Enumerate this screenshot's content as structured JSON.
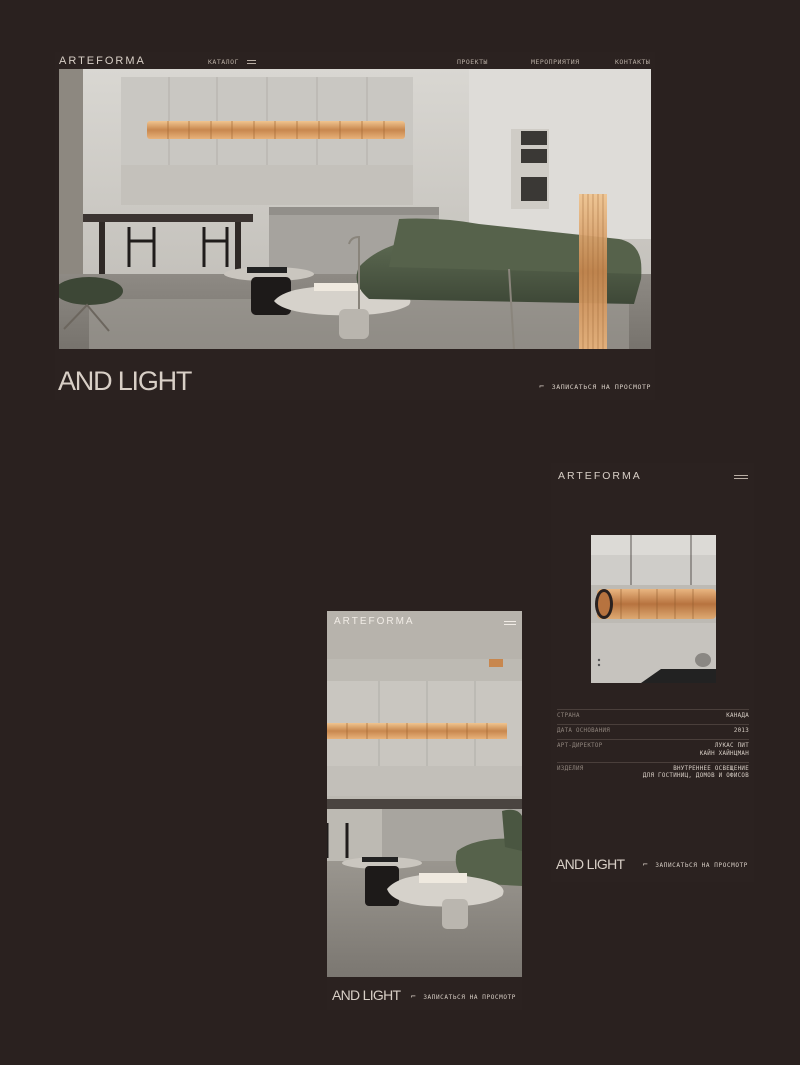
{
  "brand": {
    "logo": "ARTEFORMA"
  },
  "colors": {
    "background": "#2a211f",
    "text": "#d8cfc6",
    "muted": "#8f847c",
    "accent_lamp": "#c89a6a",
    "sofa": "#4f5b45"
  },
  "desktop": {
    "nav": {
      "catalog": "КАТАЛОГ",
      "projects": "ПРОЕКТЫ",
      "events": "МЕРОПРИЯТИЯ",
      "contacts": "КОНТАКТЫ"
    },
    "headline": "AND LIGHT",
    "cta": "ЗАПИСАТЬСЯ НА ПРОСМОТР",
    "cta_icon": "arrow-corner-icon"
  },
  "mobile_home": {
    "headline": "AND LIGHT",
    "cta": "ЗАПИСАТЬСЯ НА ПРОСМОТР"
  },
  "mobile_detail": {
    "specs": [
      {
        "label": "СТРАНА",
        "value": "КАНАДА"
      },
      {
        "label": "ДАТА ОСНОВАНИЯ",
        "value": "2013"
      },
      {
        "label": "АРТ-ДИРЕКТОР",
        "value": "ЛУКАС ПИТ\nКАЙН ХАЙНЦМАН"
      },
      {
        "label": "ИЗДЕЛИЯ",
        "value": "ВНУТРЕННЕЕ ОСВЕЩЕНИЕ\nДЛЯ ГОСТИНИЦ, ДОМОВ И ОФИСОВ"
      }
    ],
    "headline": "AND LIGHT",
    "cta": "ЗАПИСАТЬСЯ НА ПРОСМОТР"
  }
}
